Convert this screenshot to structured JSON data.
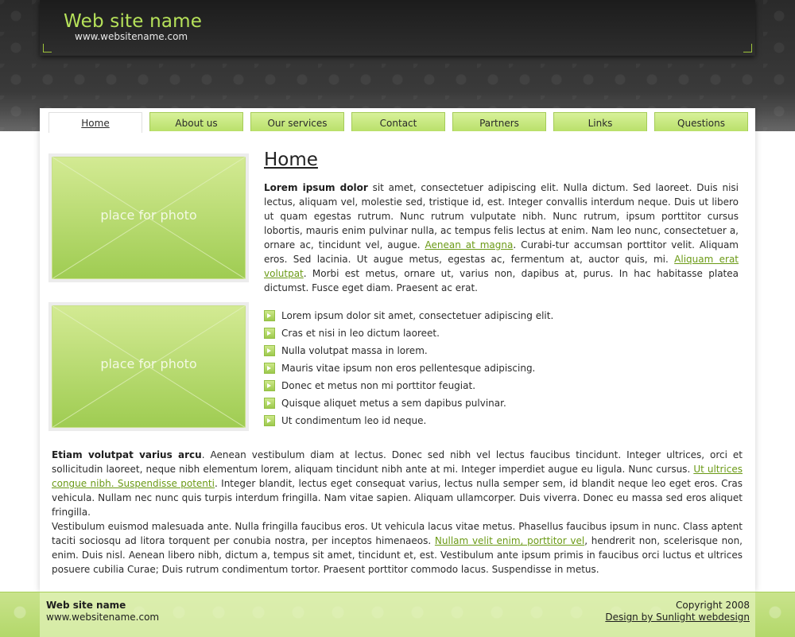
{
  "header": {
    "site_name": "Web site name",
    "site_url": "www.websitename.com"
  },
  "nav": {
    "tabs": [
      {
        "label": "Home",
        "active": true
      },
      {
        "label": "About us"
      },
      {
        "label": "Our services"
      },
      {
        "label": "Contact"
      },
      {
        "label": "Partners"
      },
      {
        "label": "Links"
      },
      {
        "label": "Questions"
      }
    ]
  },
  "photos": {
    "placeholder_text": "place for photo"
  },
  "main": {
    "title": "Home",
    "intro": {
      "bold": "Lorem ipsum dolor",
      "text1": " sit amet, consectetuer adipiscing elit. Nulla dictum. Sed laoreet. Duis nisi lectus, aliquam vel, molestie sed, tristique id, est. Integer convallis interdum neque. Duis ut libero ut quam egestas rutrum. Nunc rutrum vulputate nibh. Nunc rutrum, ipsum porttitor cursus lobortis, mauris enim pulvinar nulla, ac tempus felis lectus at enim. Nam leo nunc, consectetuer a, ornare ac, tincidunt vel, augue. ",
      "link1": "Aenean at magna",
      "text2": ". Curabi-tur accumsan porttitor velit. Aliquam eros. Sed lacinia. Ut augue metus, egestas ac, fermentum at, auctor quis, mi. ",
      "link2": "Aliquam erat volutpat",
      "text3": ". Morbi est metus, ornare ut, varius non, dapibus at, purus. In hac habitasse platea dictumst. Fusce eget diam. Praesent ac erat."
    },
    "list": [
      "Lorem ipsum dolor sit amet, consectetuer adipiscing elit.",
      "Cras et nisi in leo dictum laoreet.",
      "Nulla volutpat massa in lorem.",
      "Mauris vitae ipsum non eros pellentesque adipiscing.",
      "Donec et metus non mi porttitor feugiat.",
      "Quisque aliquet metus a sem dapibus pulvinar.",
      "Ut condimentum leo id neque."
    ],
    "para1": {
      "bold": "Etiam volutpat varius arcu",
      "text1": ". Aenean vestibulum diam at lectus. Donec sed nibh vel lectus faucibus tincidunt. Integer ultrices, orci et sollicitudin laoreet, neque nibh elementum lorem, aliquam tincidunt nibh ante at mi. Integer imperdiet augue eu ligula. Nunc cursus. ",
      "link": "Ut ultrices congue nibh. Suspendisse potenti",
      "text2": ". Integer blandit, lectus eget consequat varius, lectus nulla semper sem, id blandit neque leo eget eros. Cras vehicula. Nullam nec nunc quis turpis interdum fringilla. Nam vitae sapien. Aliquam ullamcorper. Duis viverra. Donec eu massa sed eros aliquet fringilla."
    },
    "para2": {
      "text1": "Vestibulum euismod malesuada ante. Nulla fringilla faucibus eros. Ut vehicula lacus vitae metus. Phasellus faucibus ipsum in nunc. Class aptent taciti sociosqu ad litora torquent per conubia nostra, per inceptos himenaeos. ",
      "link": "Nullam velit enim, porttitor vel",
      "text2": ", hendrerit non, scelerisque non, enim. Duis nisl. Aenean libero nibh, dictum a, tempus sit amet, tincidunt et, est. Vestibulum ante ipsum primis in faucibus orci luctus et ultrices posuere cubilia Curae; Duis rutrum condimentum tortor. Praesent porttitor commodo lacus. Suspendisse in metus."
    }
  },
  "footer": {
    "site_name": "Web site name",
    "site_url": "www.websitename.com",
    "copyright": "Copyright 2008",
    "design_credit": "Design by Sunlight webdesign"
  },
  "colors": {
    "accent": "#b6e25a",
    "link": "#6b9a16",
    "tab_bg": "#c9e87f"
  }
}
